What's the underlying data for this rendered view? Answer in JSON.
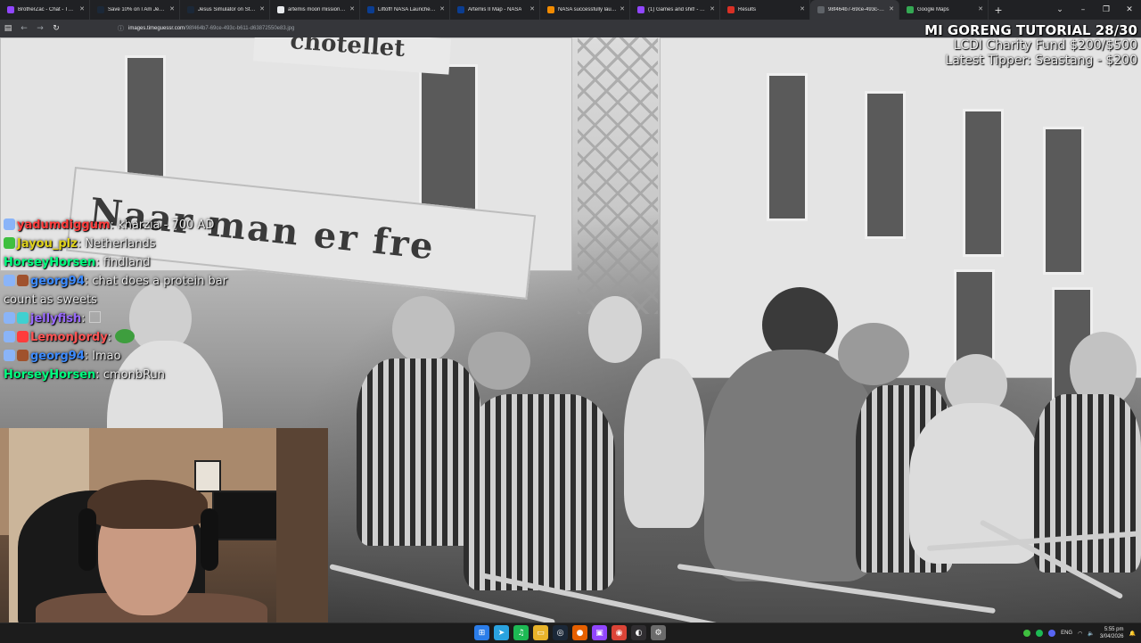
{
  "browser": {
    "tabs": [
      {
        "title": "BrotherZac - Chat - Twitch",
        "color": "#9146ff"
      },
      {
        "title": "Save 10% on I Am Jesus Ch",
        "color": "#1b2838"
      },
      {
        "title": "Jesus Simulator on Steam",
        "color": "#1b2838"
      },
      {
        "title": "artemis moon mission - Go",
        "color": "#e8eaed"
      },
      {
        "title": "Liftoff! NASA Launches Astr",
        "color": "#0b3d91"
      },
      {
        "title": "Artemis II Map - NASA",
        "color": "#0b3d91"
      },
      {
        "title": "NASA successfully launche",
        "color": "#f28b00"
      },
      {
        "title": "(1) Games and shit! - Twitch",
        "color": "#9146ff"
      },
      {
        "title": "Results",
        "color": "#d93025"
      },
      {
        "title": "98f464b7-69ce-493c-b611-d63",
        "color": "#5f6368"
      },
      {
        "title": "Google Maps",
        "color": "#34a853"
      }
    ],
    "new_tab_label": "+",
    "address": {
      "host": "images.timeguessr.com",
      "path": "/98f464b7-69ce-493c-b611-d63872550e83.jpg"
    },
    "window_controls": [
      "⌄",
      "–",
      "❐",
      "✕"
    ]
  },
  "photo": {
    "sign_text": "Naar man er fre",
    "top_sign_text": "chotellet"
  },
  "overlay": {
    "line1": "MI GORENG TUTORIAL 28/30",
    "line2": "LCDI Charity Fund $200/$500",
    "line3": "Latest Tipper: Seastang  - $200"
  },
  "chat": [
    {
      "user": "yadumdiggum",
      "user_color": "#ff3c3c",
      "text": "kharzia - 700 AD",
      "badges": [
        "#8ab4f8"
      ]
    },
    {
      "user": "Jayou_plz",
      "user_color": "#dfd21a",
      "text": "Netherlands",
      "badges": [
        "#3fbf3f"
      ]
    },
    {
      "user": "HorseyHorsen",
      "user_color": "#00ff7f",
      "text": "findland",
      "badges": []
    },
    {
      "user": "georg94",
      "user_color": "#3d8bff",
      "text": "chat does a protein bar count as sweets",
      "badges": [
        "#8ab4f8",
        "#a0522d"
      ]
    },
    {
      "user": "jellyfish",
      "user_color": "#9b6bff",
      "text": "",
      "badges": [
        "#8ab4f8",
        "#3fd0d0"
      ]
    },
    {
      "user": "LemonJordy",
      "user_color": "#ff5555",
      "text": "",
      "badges": [
        "#8ab4f8",
        "#ff3c3c"
      ]
    },
    {
      "user": "georg94",
      "user_color": "#3d8bff",
      "text": "lmao",
      "badges": [
        "#8ab4f8",
        "#a0522d"
      ]
    },
    {
      "user": "HorseyHorsen",
      "user_color": "#00ff7f",
      "text": "cmonbRun",
      "badges": []
    }
  ],
  "taskbar": {
    "icons": [
      {
        "name": "windows-start-icon",
        "color": "#2b7de9",
        "glyph": "⊞"
      },
      {
        "name": "telegram-icon",
        "color": "#2aa3e0",
        "glyph": "➤"
      },
      {
        "name": "spotify-icon",
        "color": "#1db954",
        "glyph": "♫"
      },
      {
        "name": "file-explorer-icon",
        "color": "#e8b32a",
        "glyph": "▭"
      },
      {
        "name": "steam-icon",
        "color": "#1b2838",
        "glyph": "◎"
      },
      {
        "name": "firefox-icon",
        "color": "#e66000",
        "glyph": "●"
      },
      {
        "name": "twitch-icon",
        "color": "#9146ff",
        "glyph": "▣"
      },
      {
        "name": "chrome-icon",
        "color": "#db4437",
        "glyph": "◉"
      },
      {
        "name": "obs-icon",
        "color": "#302e31",
        "glyph": "◐"
      },
      {
        "name": "settings-icon",
        "color": "#6b6b6b",
        "glyph": "⚙"
      }
    ],
    "language": "ENG",
    "time": "5:55 pm",
    "date": "3/04/2026"
  }
}
